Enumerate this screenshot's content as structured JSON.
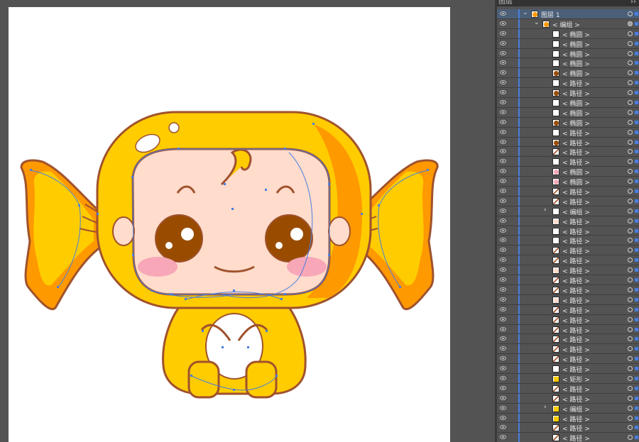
{
  "panel": {
    "title": "图层",
    "menu_icon": "››"
  },
  "colors": {
    "body_yellow": "#ffcc00",
    "orange": "#ff9900",
    "outline": "#a0522d",
    "skin": "#ffdccc",
    "eye_brown": "#994c00",
    "cheek_pink": "#f7a7b8",
    "path_blue": "#4a7ee0"
  },
  "layers": [
    {
      "label": "图层 1",
      "depth": 0,
      "expander": "⌄",
      "thumb": "char",
      "selected": true,
      "target_filled": false
    },
    {
      "label": "< 编组 >",
      "depth": 1,
      "expander": "⌄",
      "thumb": "char",
      "selected": false,
      "target_filled": true
    },
    {
      "label": "< 椭圆 >",
      "depth": 2,
      "thumb": "white"
    },
    {
      "label": "< 椭圆 >",
      "depth": 2,
      "thumb": "white"
    },
    {
      "label": "< 椭圆 >",
      "depth": 2,
      "thumb": "white"
    },
    {
      "label": "< 椭圆 >",
      "depth": 2,
      "thumb": "white"
    },
    {
      "label": "< 椭圆 >",
      "depth": 2,
      "thumb": "brown"
    },
    {
      "label": "< 路径 >",
      "depth": 2,
      "thumb": "white"
    },
    {
      "label": "< 路径 >",
      "depth": 2,
      "thumb": "brown"
    },
    {
      "label": "< 椭圆 >",
      "depth": 2,
      "thumb": "white"
    },
    {
      "label": "< 椭圆 >",
      "depth": 2,
      "thumb": "white"
    },
    {
      "label": "< 椭圆 >",
      "depth": 2,
      "thumb": "brown"
    },
    {
      "label": "< 路径 >",
      "depth": 2,
      "thumb": "white"
    },
    {
      "label": "< 路径 >",
      "depth": 2,
      "thumb": "brown"
    },
    {
      "label": "< 路径 >",
      "depth": 2,
      "thumb": "stroke"
    },
    {
      "label": "< 路径 >",
      "depth": 2,
      "thumb": "white"
    },
    {
      "label": "< 椭圆 >",
      "depth": 2,
      "thumb": "pink"
    },
    {
      "label": "< 椭圆 >",
      "depth": 2,
      "thumb": "pink"
    },
    {
      "label": "< 路径 >",
      "depth": 2,
      "thumb": "stroke"
    },
    {
      "label": "< 路径 >",
      "depth": 2,
      "thumb": "stroke"
    },
    {
      "label": "< 编组 >",
      "depth": 2,
      "expander": "›",
      "thumb": "white"
    },
    {
      "label": "< 路径 >",
      "depth": 2,
      "thumb": "skin"
    },
    {
      "label": "< 路径 >",
      "depth": 2,
      "thumb": "white"
    },
    {
      "label": "< 路径 >",
      "depth": 2,
      "thumb": "white"
    },
    {
      "label": "< 路径 >",
      "depth": 2,
      "thumb": "stroke"
    },
    {
      "label": "< 路径 >",
      "depth": 2,
      "thumb": "stroke"
    },
    {
      "label": "< 路径 >",
      "depth": 2,
      "thumb": "skin"
    },
    {
      "label": "< 路径 >",
      "depth": 2,
      "thumb": "stroke"
    },
    {
      "label": "< 路径 >",
      "depth": 2,
      "thumb": "stroke"
    },
    {
      "label": "< 路径 >",
      "depth": 2,
      "thumb": "skin"
    },
    {
      "label": "< 路径 >",
      "depth": 2,
      "thumb": "stroke"
    },
    {
      "label": "< 路径 >",
      "depth": 2,
      "thumb": "stroke"
    },
    {
      "label": "< 路径 >",
      "depth": 2,
      "thumb": "stroke"
    },
    {
      "label": "< 路径 >",
      "depth": 2,
      "thumb": "stroke"
    },
    {
      "label": "< 路径 >",
      "depth": 2,
      "thumb": "stroke"
    },
    {
      "label": "< 路径 >",
      "depth": 2,
      "thumb": "stroke"
    },
    {
      "label": "< 路径 >",
      "depth": 2,
      "thumb": "white"
    },
    {
      "label": "< 矩形 >",
      "depth": 2,
      "thumb": "yellow"
    },
    {
      "label": "< 路径 >",
      "depth": 2,
      "thumb": "stroke"
    },
    {
      "label": "< 路径 >",
      "depth": 2,
      "thumb": "stroke"
    },
    {
      "label": "< 编组 >",
      "depth": 2,
      "expander": "›",
      "thumb": "yellow"
    },
    {
      "label": "< 路径 >",
      "depth": 2,
      "thumb": "yellow"
    },
    {
      "label": "< 路径 >",
      "depth": 2,
      "thumb": "stroke"
    },
    {
      "label": "< 路径 >",
      "depth": 2,
      "thumb": "stroke"
    }
  ]
}
